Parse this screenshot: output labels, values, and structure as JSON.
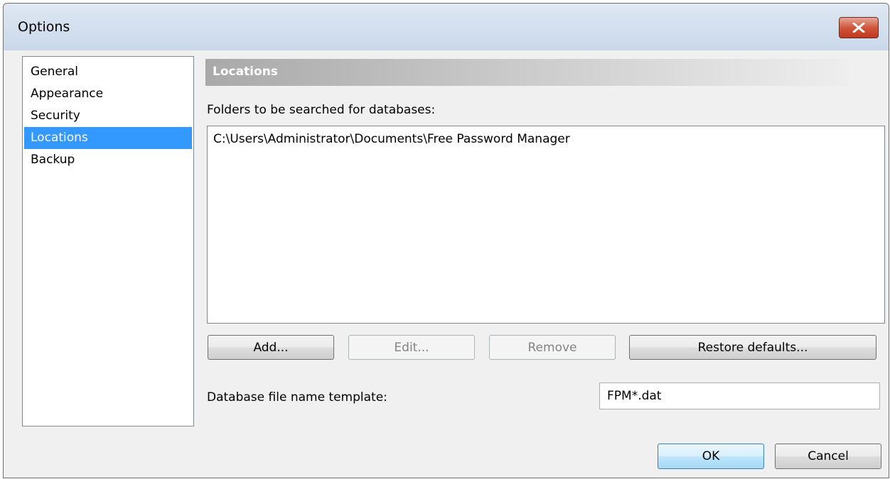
{
  "window": {
    "title": "Options"
  },
  "nav": {
    "items": [
      {
        "label": "General",
        "selected": false
      },
      {
        "label": "Appearance",
        "selected": false
      },
      {
        "label": "Security",
        "selected": false
      },
      {
        "label": "Locations",
        "selected": true
      },
      {
        "label": "Backup",
        "selected": false
      }
    ]
  },
  "section": {
    "title": "Locations",
    "folders_label": "Folders to be searched for databases:",
    "folders": [
      "C:\\Users\\Administrator\\Documents\\Free Password Manager"
    ]
  },
  "buttons": {
    "add": "Add...",
    "edit": "Edit...",
    "remove": "Remove",
    "restore": "Restore defaults...",
    "ok": "OK",
    "cancel": "Cancel"
  },
  "template": {
    "label": "Database file name template:",
    "value": "FPM*.dat"
  },
  "colors": {
    "selection": "#3399ff",
    "close_button": "#c7432a"
  },
  "icons": {
    "close": "close-icon"
  }
}
